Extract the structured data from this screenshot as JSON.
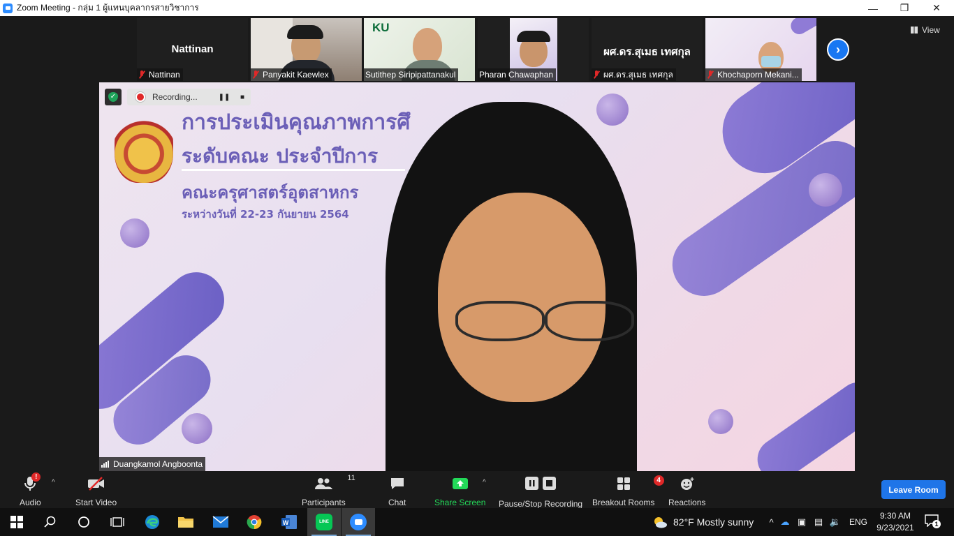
{
  "window": {
    "title": "Zoom Meeting - กลุ่ม 1 ผู้แทนบุคลากรสายวิชาการ"
  },
  "gallery": {
    "tiles": [
      {
        "name": "Nattinan",
        "display_name": "Nattinan",
        "muted": true
      },
      {
        "name": "Panyakit Kaewlex",
        "muted": true
      },
      {
        "name": "Sutithep Siripipattanakul",
        "muted": false,
        "logo_text": "KU"
      },
      {
        "name": "Pharan Chawaphan",
        "muted": false
      },
      {
        "name": "ผศ.ดร.สุเมธ เทศกุล",
        "display_name": "ผศ.ดร.สุเมธ เทศกุล",
        "muted": true
      },
      {
        "name": "Khochaporn Mekani...",
        "muted": true
      }
    ],
    "view_label": "View"
  },
  "recording": {
    "status": "Recording..."
  },
  "main_video": {
    "speaker": "Duangkamol Angboonta",
    "slide_lines": [
      "การประเมินคุณภาพการศึ",
      "ระดับคณะ ประจำปีการ",
      "คณะครุศาสตร์อุตสาหกร",
      "ระหว่างวันที่ 22-23 กันยายน 2564"
    ]
  },
  "toolbar": {
    "audio": "Audio",
    "start_video": "Start Video",
    "participants": "Participants",
    "participants_count": "11",
    "chat": "Chat",
    "share_screen": "Share Screen",
    "pause_stop": "Pause/Stop Recording",
    "breakout": "Breakout Rooms",
    "breakout_badge": "4",
    "reactions": "Reactions",
    "leave": "Leave Room",
    "audio_alert": "!"
  },
  "taskbar": {
    "weather": "82°F  Mostly sunny",
    "lang": "ENG",
    "time": "9:30 AM",
    "date": "9/23/2021",
    "notifications": "1",
    "line_label": "LINE"
  },
  "colors": {
    "accent": "#2d8cff",
    "share_green": "#23d959",
    "leave_blue": "#1f75e8",
    "muted_red": "#e02828"
  }
}
